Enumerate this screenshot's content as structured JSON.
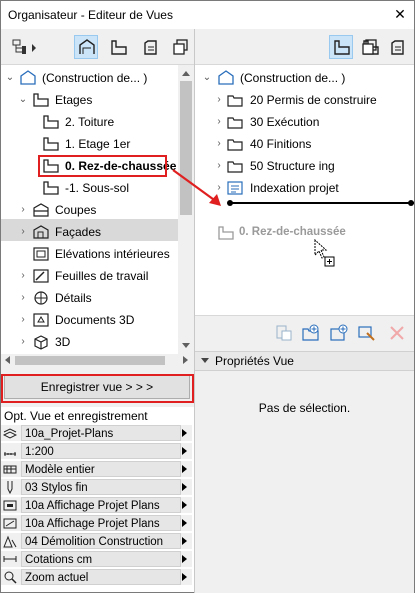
{
  "window": {
    "title": "Organisateur - Editeur de Vues",
    "close_glyph": "✕"
  },
  "left_toolbar": {
    "icons": [
      "project-map-dropdown-icon",
      "view-map-icon",
      "layout-book-icon",
      "publisher-sets-icon",
      "stack-icon"
    ]
  },
  "left_tree": {
    "items": [
      {
        "label": "(Construction de... )",
        "icon": "view-map-root-icon",
        "expanded": true
      },
      {
        "label": "Etages",
        "icon": "floor-plan-icon",
        "expanded": true
      },
      {
        "label": "2. Toiture",
        "icon": "story-icon"
      },
      {
        "label": "1. Etage 1er",
        "icon": "story-icon"
      },
      {
        "label": "0. Rez-de-chaussée",
        "icon": "story-icon",
        "selected": true
      },
      {
        "label": "-1. Sous-sol",
        "icon": "story-icon"
      },
      {
        "label": "Coupes",
        "icon": "section-icon"
      },
      {
        "label": "Façades",
        "icon": "elevation-icon"
      },
      {
        "label": "Elévations intérieures",
        "icon": "interior-elevation-icon"
      },
      {
        "label": "Feuilles de travail",
        "icon": "worksheet-icon"
      },
      {
        "label": "Détails",
        "icon": "detail-icon"
      },
      {
        "label": "Documents 3D",
        "icon": "3d-document-icon"
      },
      {
        "label": "3D",
        "icon": "3d-icon"
      }
    ]
  },
  "save_button": {
    "label": "Enregistrer vue > > >"
  },
  "options": {
    "heading": "Opt. Vue et enregistrement",
    "rows": [
      {
        "value": "10a_Projet-Plans",
        "icon": "layers-icon"
      },
      {
        "value": "1:200",
        "icon": "scale-icon"
      },
      {
        "value": "Modèle entier",
        "icon": "structure-display-icon"
      },
      {
        "value": "03 Stylos fin",
        "icon": "pen-icon"
      },
      {
        "value": "10a Affichage Projet Plans",
        "icon": "model-view-icon"
      },
      {
        "value": "10a Affichage Projet Plans",
        "icon": "graphic-override-icon"
      },
      {
        "value": "04 Démolition Construction",
        "icon": "renovation-icon"
      },
      {
        "value": "Cotations cm",
        "icon": "dimension-icon"
      },
      {
        "value": "Zoom actuel",
        "icon": "zoom-icon"
      }
    ]
  },
  "right_tree": {
    "items": [
      {
        "label": "(Construction de... )",
        "icon": "view-map-root-icon",
        "expanded": true
      },
      {
        "label": "20 Permis de construire",
        "icon": "folder-icon"
      },
      {
        "label": "30 Exécution",
        "icon": "folder-icon"
      },
      {
        "label": "40 Finitions",
        "icon": "folder-icon"
      },
      {
        "label": "50 Structure ing",
        "icon": "folder-icon"
      },
      {
        "label": "Indexation projet",
        "icon": "index-icon"
      }
    ],
    "drag_ghost": "0. Rez-de-chaussée"
  },
  "properties": {
    "heading": "Propriétés Vue",
    "empty_text": "Pas de sélection."
  },
  "colors": {
    "highlight": "#e02020",
    "selection": "#d9d9d9",
    "active_tool": "#cce4f7"
  }
}
